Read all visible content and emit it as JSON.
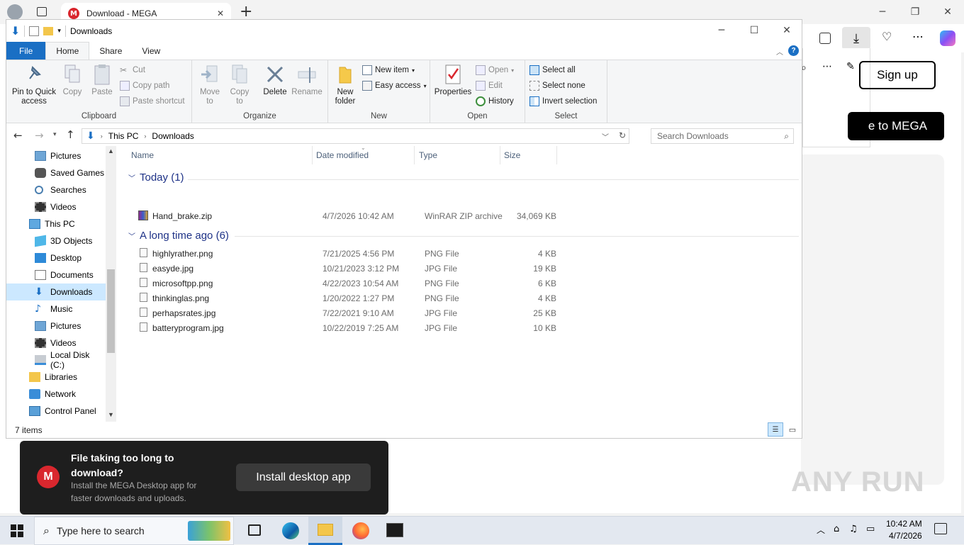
{
  "browser": {
    "tab_title": "Download - MEGA",
    "tab_close": "✕",
    "new_tab": "+",
    "signup_label": "Sign up",
    "mega_cta_fragment": "e to MEGA"
  },
  "explorer": {
    "title": "Downloads",
    "ribbon_tabs": [
      "File",
      "Home",
      "Share",
      "View"
    ],
    "clipboard": {
      "pin": "Pin to Quick access",
      "copy": "Copy",
      "paste": "Paste",
      "cut": "Cut",
      "copy_path": "Copy path",
      "paste_shortcut": "Paste shortcut",
      "label": "Clipboard"
    },
    "organize": {
      "move_to": "Move to",
      "copy_to": "Copy to",
      "delete": "Delete",
      "rename": "Rename",
      "label": "Organize"
    },
    "new": {
      "new_folder": "New folder",
      "new_item": "New item",
      "easy_access": "Easy access",
      "label": "New"
    },
    "open": {
      "properties": "Properties",
      "open": "Open",
      "edit": "Edit",
      "history": "History",
      "label": "Open"
    },
    "select": {
      "select_all": "Select all",
      "select_none": "Select none",
      "invert": "Invert selection",
      "label": "Select"
    },
    "breadcrumb": [
      "This PC",
      "Downloads"
    ],
    "search_placeholder": "Search Downloads",
    "columns": {
      "name": "Name",
      "date": "Date modified",
      "type": "Type",
      "size": "Size"
    },
    "nav_items": [
      {
        "label": "Pictures",
        "icon": "pictures-icon"
      },
      {
        "label": "Saved Games",
        "icon": "saved-games-icon"
      },
      {
        "label": "Searches",
        "icon": "searches-icon"
      },
      {
        "label": "Videos",
        "icon": "videos-icon"
      },
      {
        "label": "This PC",
        "icon": "this-pc-icon"
      },
      {
        "label": "3D Objects",
        "icon": "3d-objects-icon"
      },
      {
        "label": "Desktop",
        "icon": "desktop-icon"
      },
      {
        "label": "Documents",
        "icon": "documents-icon"
      },
      {
        "label": "Downloads",
        "icon": "downloads-icon"
      },
      {
        "label": "Music",
        "icon": "music-icon"
      },
      {
        "label": "Pictures",
        "icon": "pictures-icon"
      },
      {
        "label": "Videos",
        "icon": "videos-icon"
      },
      {
        "label": "Local Disk (C:)",
        "icon": "local-disk-icon"
      },
      {
        "label": "Libraries",
        "icon": "libraries-icon"
      },
      {
        "label": "Network",
        "icon": "network-icon"
      },
      {
        "label": "Control Panel",
        "icon": "control-panel-icon"
      }
    ],
    "groups": [
      {
        "label": "Today (1)",
        "files": [
          {
            "name": "Hand_brake.zip",
            "date": "4/7/2026 10:42 AM",
            "type": "WinRAR ZIP archive",
            "size": "34,069 KB"
          }
        ]
      },
      {
        "label": "A long time ago (6)",
        "files": [
          {
            "name": "highlyrather.png",
            "date": "7/21/2025 4:56 PM",
            "type": "PNG File",
            "size": "4 KB"
          },
          {
            "name": "easyde.jpg",
            "date": "10/21/2023 3:12 PM",
            "type": "JPG File",
            "size": "19 KB"
          },
          {
            "name": "microsoftpp.png",
            "date": "4/22/2023 10:54 AM",
            "type": "PNG File",
            "size": "6 KB"
          },
          {
            "name": "thinkinglas.png",
            "date": "1/20/2022 1:27 PM",
            "type": "PNG File",
            "size": "4 KB"
          },
          {
            "name": "perhapsrates.jpg",
            "date": "7/22/2021 9:10 AM",
            "type": "JPG File",
            "size": "25 KB"
          },
          {
            "name": "batteryprogram.jpg",
            "date": "10/22/2019 7:25 AM",
            "type": "JPG File",
            "size": "10 KB"
          }
        ]
      }
    ],
    "status": "7 items"
  },
  "toast": {
    "title": "File taking too long to download?",
    "body": "Install the MEGA Desktop app for faster downloads and uploads.",
    "button": "Install desktop app"
  },
  "taskbar": {
    "search_placeholder": "Type here to search",
    "time": "10:42 AM",
    "date": "4/7/2026"
  },
  "watermark": "ANY RUN",
  "colors": {
    "accent": "#1a6fc4",
    "mega_red": "#d9272e",
    "selection": "#cce8ff"
  }
}
